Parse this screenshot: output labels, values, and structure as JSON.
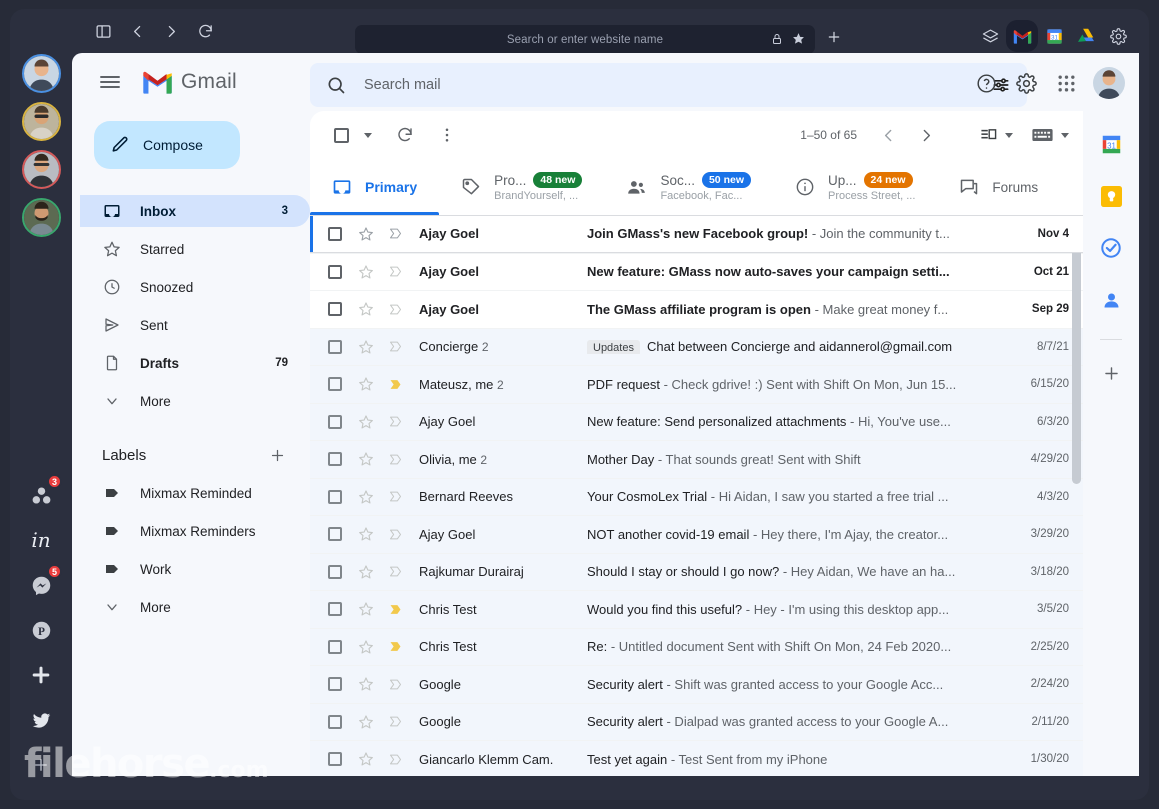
{
  "browser": {
    "nav": {
      "sidebar_toggle": "sidebar-toggle",
      "back": "back",
      "forward": "forward",
      "reload": "reload"
    },
    "url_placeholder": "Search or enter website name",
    "url_value": "",
    "lock_icon": "lock-icon",
    "star_icon": "star-icon",
    "newtab_icon": "plus-icon",
    "apps": [
      {
        "name": "layers-icon",
        "label": "Layers",
        "active": false
      },
      {
        "name": "gmail-icon",
        "label": "Gmail",
        "active": true
      },
      {
        "name": "google-calendar-icon",
        "label": "Calendar",
        "active": false
      },
      {
        "name": "google-drive-icon",
        "label": "Drive",
        "active": false
      },
      {
        "name": "settings-gear-icon",
        "label": "Settings",
        "active": false
      }
    ]
  },
  "rail": {
    "accounts": [
      {
        "name": "account-avatar-1",
        "ring": "#4a90e2"
      },
      {
        "name": "account-avatar-2",
        "ring": "#d9b441"
      },
      {
        "name": "account-avatar-3",
        "ring": "#d45a5a"
      },
      {
        "name": "account-avatar-4",
        "ring": "#3aa76d"
      }
    ],
    "apps": [
      {
        "name": "asana-icon",
        "badge": "3"
      },
      {
        "name": "linkedin-icon",
        "badge": ""
      },
      {
        "name": "messenger-icon",
        "badge": "5"
      },
      {
        "name": "pinterest-icon",
        "badge": ""
      },
      {
        "name": "slack-icon",
        "badge": ""
      },
      {
        "name": "twitter-icon",
        "badge": ""
      },
      {
        "name": "add-app-icon",
        "badge": ""
      }
    ]
  },
  "gmail": {
    "brand": "Gmail",
    "menu_icon": "hamburger-menu-icon",
    "search": {
      "placeholder": "Search mail",
      "value": "",
      "icon": "search-icon",
      "filter_icon": "search-options-icon"
    },
    "header_icons": [
      {
        "name": "help-icon"
      },
      {
        "name": "settings-gear-icon"
      },
      {
        "name": "google-apps-grid-icon"
      }
    ],
    "account_avatar": "account-avatar",
    "compose": {
      "label": "Compose",
      "icon": "pencil-icon"
    },
    "nav_items": [
      {
        "label": "Inbox",
        "icon": "inbox-icon",
        "count": "3",
        "active": true,
        "bold": true
      },
      {
        "label": "Starred",
        "icon": "star-icon",
        "count": "",
        "active": false,
        "bold": false
      },
      {
        "label": "Snoozed",
        "icon": "clock-icon",
        "count": "",
        "active": false,
        "bold": false
      },
      {
        "label": "Sent",
        "icon": "send-icon",
        "count": "",
        "active": false,
        "bold": false
      },
      {
        "label": "Drafts",
        "icon": "draft-icon",
        "count": "79",
        "active": false,
        "bold": true
      },
      {
        "label": "More",
        "icon": "chevron-down-icon",
        "count": "",
        "active": false,
        "bold": false
      }
    ],
    "labels_header": {
      "title": "Labels",
      "add_icon": "plus-icon"
    },
    "labels": [
      {
        "label": "Mixmax Reminded",
        "icon": "label-icon"
      },
      {
        "label": "Mixmax Reminders",
        "icon": "label-icon"
      },
      {
        "label": "Work",
        "icon": "label-icon"
      },
      {
        "label": "More",
        "icon": "chevron-down-icon"
      }
    ],
    "toolbar": {
      "select_all_icon": "checkbox-icon",
      "select_caret_icon": "chevron-down-icon",
      "refresh_icon": "refresh-icon",
      "more_icon": "more-vertical-icon",
      "range": "1–50 of 65",
      "prev_icon": "chevron-left-icon",
      "next_icon": "chevron-right-icon",
      "density_icon": "input-tools-icon",
      "keyboard_icon": "keyboard-icon"
    },
    "tabs": [
      {
        "name": "Primary",
        "icon": "inbox-tab-icon",
        "badge": "",
        "badge_color": "",
        "sub": "",
        "active": true
      },
      {
        "name": "Pro...",
        "icon": "tag-icon",
        "badge": "48 new",
        "badge_color": "#188038",
        "sub": "BrandYourself, ...",
        "active": false
      },
      {
        "name": "Soc...",
        "icon": "people-icon",
        "badge": "50 new",
        "badge_color": "#1a73e8",
        "sub": "Facebook, Fac...",
        "active": false
      },
      {
        "name": "Up...",
        "icon": "info-icon",
        "badge": "24 new",
        "badge_color": "#e37400",
        "sub": "Process Street, ...",
        "active": false
      },
      {
        "name": "Forums",
        "icon": "forum-icon",
        "badge": "",
        "badge_color": "",
        "sub": "",
        "active": false
      }
    ],
    "rows": [
      {
        "sender": "Ajay Goel",
        "count": "",
        "chip": "",
        "subject": "Join GMass's new Facebook group!",
        "snippet": " - Join the community t...",
        "date": "Nov 4",
        "unread": true,
        "selected": true,
        "important": false
      },
      {
        "sender": "Ajay Goel",
        "count": "",
        "chip": "",
        "subject": "New feature: GMass now auto-saves your campaign setti...",
        "snippet": "",
        "date": "Oct 21",
        "unread": true,
        "selected": false,
        "important": false
      },
      {
        "sender": "Ajay Goel",
        "count": "",
        "chip": "",
        "subject": "The GMass affiliate program is open",
        "snippet": " - Make great money f...",
        "date": "Sep 29",
        "unread": true,
        "selected": false,
        "important": false
      },
      {
        "sender": "Concierge",
        "count": "2",
        "chip": "Updates",
        "subject": "Chat between Concierge and aidannerol@gmail.com",
        "snippet": "",
        "date": "8/7/21",
        "unread": false,
        "selected": false,
        "important": false
      },
      {
        "sender": "Mateusz, me",
        "count": "2",
        "chip": "",
        "subject": "PDF request",
        "snippet": " - Check gdrive! :) Sent with Shift On Mon, Jun 15...",
        "date": "6/15/20",
        "unread": false,
        "selected": false,
        "important": true
      },
      {
        "sender": "Ajay Goel",
        "count": "",
        "chip": "",
        "subject": "New feature: Send personalized attachments",
        "snippet": " - Hi, You've use...",
        "date": "6/3/20",
        "unread": false,
        "selected": false,
        "important": false
      },
      {
        "sender": "Olivia, me",
        "count": "2",
        "chip": "",
        "subject": "Mother Day",
        "snippet": " - That sounds great! Sent with Shift",
        "date": "4/29/20",
        "unread": false,
        "selected": false,
        "important": false
      },
      {
        "sender": "Bernard Reeves",
        "count": "",
        "chip": "",
        "subject": "Your CosmoLex Trial",
        "snippet": " - Hi Aidan, I saw you started a free trial ...",
        "date": "4/3/20",
        "unread": false,
        "selected": false,
        "important": false
      },
      {
        "sender": "Ajay Goel",
        "count": "",
        "chip": "",
        "subject": "NOT another covid-19 email",
        "snippet": " - Hey there, I'm Ajay, the creator...",
        "date": "3/29/20",
        "unread": false,
        "selected": false,
        "important": false
      },
      {
        "sender": "Rajkumar Durairaj",
        "count": "",
        "chip": "",
        "subject": "Should I stay or should I go now?",
        "snippet": " - Hey Aidan, We have an ha...",
        "date": "3/18/20",
        "unread": false,
        "selected": false,
        "important": false
      },
      {
        "sender": "Chris Test",
        "count": "",
        "chip": "",
        "subject": "Would you find this useful?",
        "snippet": " - Hey - I'm using this desktop app...",
        "date": "3/5/20",
        "unread": false,
        "selected": false,
        "important": true
      },
      {
        "sender": "Chris Test",
        "count": "",
        "chip": "",
        "subject": "Re:",
        "snippet": " - Untitled document Sent with Shift On Mon, 24 Feb 2020...",
        "date": "2/25/20",
        "unread": false,
        "selected": false,
        "important": true
      },
      {
        "sender": "Google",
        "count": "",
        "chip": "",
        "subject": "Security alert",
        "snippet": " - Shift was granted access to your Google Acc...",
        "date": "2/24/20",
        "unread": false,
        "selected": false,
        "important": false
      },
      {
        "sender": "Google",
        "count": "",
        "chip": "",
        "subject": "Security alert",
        "snippet": " - Dialpad was granted access to your Google A...",
        "date": "2/11/20",
        "unread": false,
        "selected": false,
        "important": false
      },
      {
        "sender": "Giancarlo Klemm Cam.",
        "count": "",
        "chip": "",
        "subject": "Test yet again",
        "snippet": " - Test Sent from my iPhone",
        "date": "1/30/20",
        "unread": false,
        "selected": false,
        "important": false
      }
    ],
    "right_rail": [
      {
        "name": "google-calendar-icon"
      },
      {
        "name": "google-keep-icon"
      },
      {
        "name": "google-tasks-icon"
      },
      {
        "name": "google-contacts-icon"
      }
    ],
    "right_rail_add": "add-addon-icon"
  },
  "watermark": {
    "text": "filehorse",
    "suffix": ".com"
  }
}
